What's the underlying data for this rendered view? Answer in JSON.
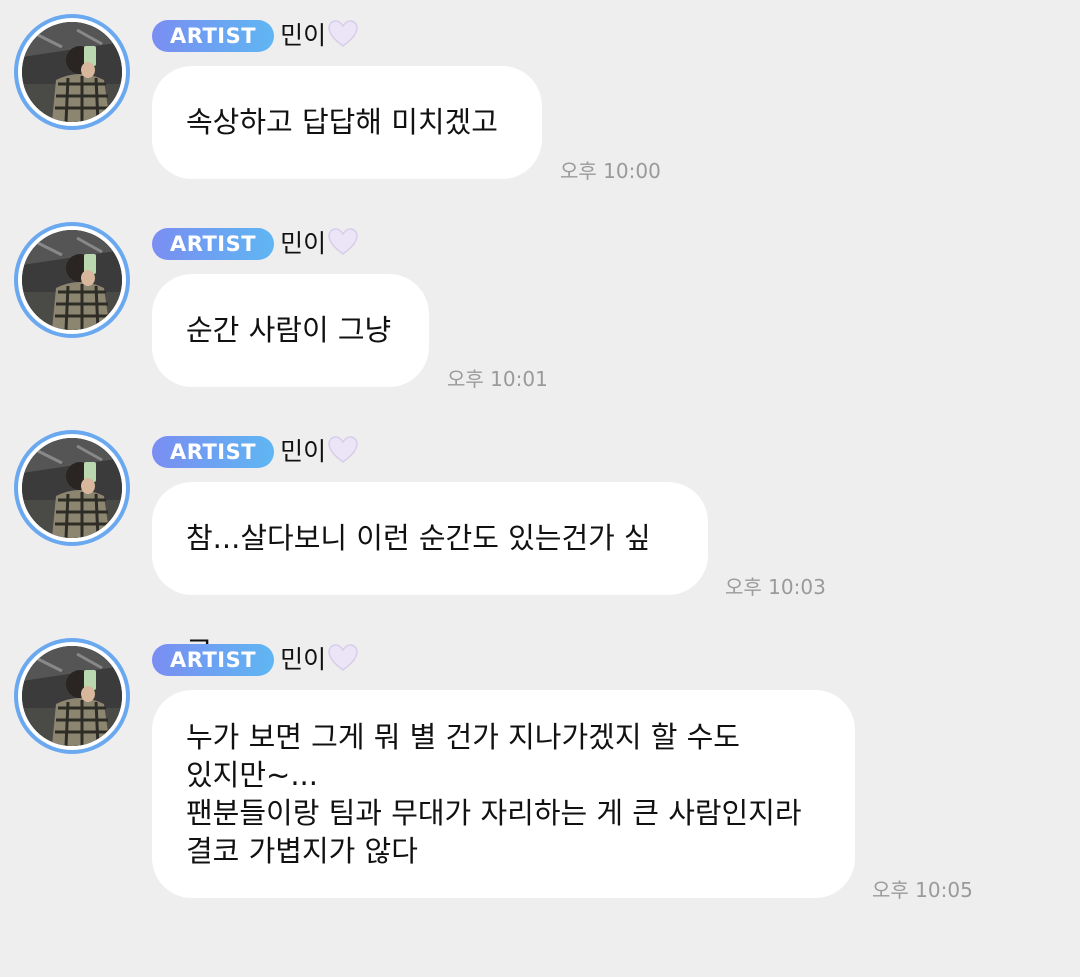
{
  "messages": [
    {
      "badge": "ARTIST",
      "name": "민이",
      "text": "속상하고 답답해 미치겠고",
      "time": "오후 10:00"
    },
    {
      "badge": "ARTIST",
      "name": "민이",
      "text": "순간 사람이 그냥",
      "time": "오후 10:01"
    },
    {
      "badge": "ARTIST",
      "name": "민이",
      "text": "참...살다보니 이런 순간도 있는건가 싶고",
      "time": "오후 10:03"
    },
    {
      "badge": "ARTIST",
      "name": "민이",
      "text": "누가 보면 그게 뭐 별 건가 지나가겠지 할 수도\n있지만~...\n팬분들이랑 팀과 무대가 자리하는 게 큰 사람인지라\n결코 가볍지가 않다",
      "time": "오후 10:05"
    }
  ],
  "colors": {
    "background": "#eeeeee",
    "bubble": "#ffffff",
    "badge_start": "#7a8ef2",
    "badge_end": "#5fb6f2",
    "avatar_ring": "#6aa8f0",
    "heart": "#ece4f7",
    "timestamp": "#9a9a9a"
  },
  "icons": {
    "heart": "white-heart-icon",
    "avatar": "profile-photo"
  }
}
